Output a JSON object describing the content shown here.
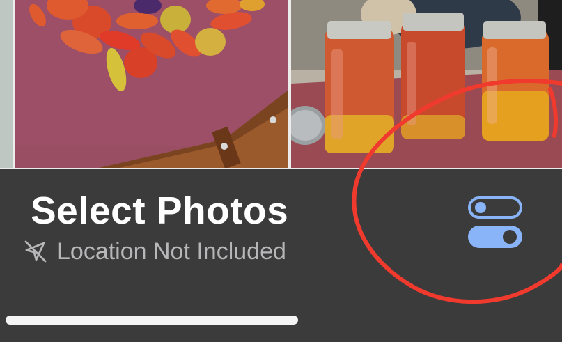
{
  "sheet": {
    "title": "Select Photos",
    "location_status": "Location Not Included",
    "location_icon": "location-slash-icon",
    "options_icon": "toggles-icon"
  },
  "photos": [
    {
      "content": "tomatoes and peppers on counter"
    },
    {
      "content": "canned tomato jars on counter"
    }
  ],
  "colors": {
    "sheet_background": "#3c3b3b",
    "accent": "#8ab4f8",
    "annotation": "#ff3b30"
  }
}
